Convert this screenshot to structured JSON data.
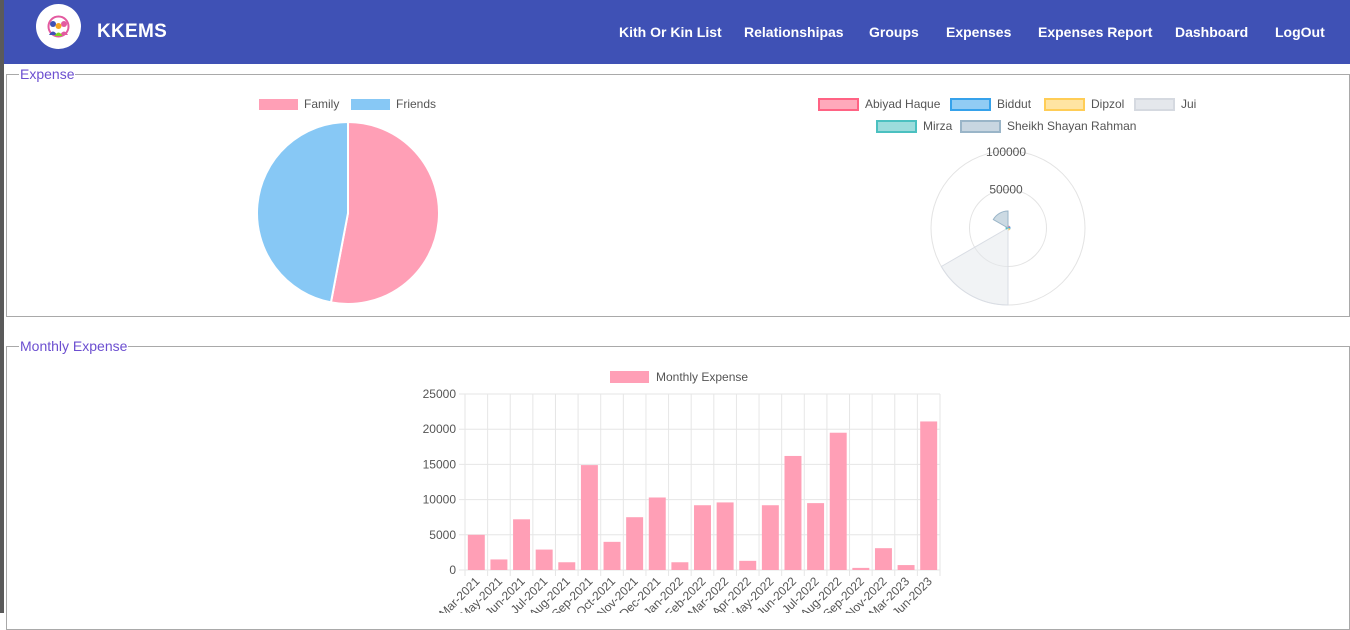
{
  "app": {
    "brand": "KKEMS",
    "logo_icon": "family-group-icon"
  },
  "nav": {
    "items": [
      {
        "label": "Kith Or Kin List"
      },
      {
        "label": "Relationshipas"
      },
      {
        "label": "Groups"
      },
      {
        "label": "Expenses"
      },
      {
        "label": "Expenses Report"
      },
      {
        "label": "Dashboard"
      },
      {
        "label": "LogOut"
      }
    ]
  },
  "colors": {
    "navbar": "#3f51b5",
    "legend_text": "#6c4fd0",
    "pink": "#ff9fb6",
    "blue": "#87c8f5"
  },
  "sections": {
    "expense_legend": "Expense",
    "monthly_legend": "Monthly Expense"
  },
  "chart_data": [
    {
      "type": "pie",
      "labels": [
        "Family",
        "Friends"
      ],
      "values": [
        53,
        47
      ],
      "colors": [
        "#ff9fb6",
        "#87c8f5"
      ],
      "legend_position": "top"
    },
    {
      "type": "polarArea",
      "labels": [
        "Abiyad Haque",
        "Biddut",
        "Dipzol",
        "Jui",
        "Mirza",
        "Sheikh Shayan Rahman"
      ],
      "values": [
        1500,
        400,
        200,
        100000,
        400,
        22000
      ],
      "colors": [
        "#ff6384",
        "#36a2eb",
        "#ffcd56",
        "#e4e7ec",
        "#4bc0c0",
        "#9ab5c8"
      ],
      "ticks": [
        "100000",
        "50000"
      ],
      "rmax": 100000,
      "legend_position": "top"
    },
    {
      "type": "bar",
      "series": [
        {
          "name": "Monthly Expense",
          "values": [
            5000,
            1500,
            7200,
            2900,
            1100,
            14900,
            4000,
            7500,
            10300,
            1100,
            9200,
            9600,
            1300,
            9200,
            16200,
            9500,
            19500,
            300,
            3100,
            700,
            21100
          ]
        }
      ],
      "categories": [
        "Mar-2021",
        "May-2021",
        "Jun-2021",
        "Jul-2021",
        "Aug-2021",
        "Sep-2021",
        "Oct-2021",
        "Nov-2021",
        "Dec-2021",
        "Jan-2022",
        "Feb-2022",
        "Mar-2022",
        "Apr-2022",
        "May-2022",
        "Jun-2022",
        "Jul-2022",
        "Aug-2022",
        "Sep-2022",
        "Nov-2022",
        "Mar-2023",
        "Jun-2023"
      ],
      "yticks": [
        "25000",
        "20000",
        "15000",
        "10000",
        "5000",
        "0"
      ],
      "ylim": [
        0,
        25000
      ],
      "color": "#ff9fb6",
      "grid": true,
      "legend_position": "top"
    }
  ]
}
